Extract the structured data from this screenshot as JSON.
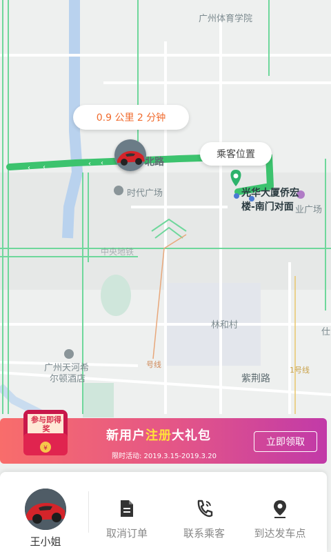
{
  "map": {
    "labels": {
      "sports_college": "广州体育学院",
      "times_square": "时代广场",
      "plaza_partial": "业广场",
      "metro_partial": "中央地铁",
      "linhe_village": "林和村",
      "hilton_line1": "广州天河希",
      "hilton_line2": "尔顿酒店",
      "zijing_road": "紫荆路",
      "road_north": "北路",
      "line_tag_left": "号线",
      "line_tag_right": "1号线",
      "right_edge": "仕"
    },
    "eta_text": "0.9 公里 2 分钟",
    "passenger_location_label": "乘客位置",
    "pickup_line1": "光华大厦侨宏",
    "pickup_line2": "楼-南门对面",
    "route_color": "#3cc36e",
    "pin_color": "#2db36b"
  },
  "promo": {
    "badge": "参与即得奖",
    "title_pre": "新用户",
    "title_highlight": "注册",
    "title_post": "大礼包",
    "date": "限时活动: 2019.3.15-2019.3.20",
    "button": "立即领取"
  },
  "panel": {
    "user_name": "王小姐",
    "actions": [
      {
        "label": "取消订单",
        "icon": "document-icon"
      },
      {
        "label": "联系乘客",
        "icon": "phone-icon"
      },
      {
        "label": "到达发车点",
        "icon": "location-pin-icon"
      }
    ]
  }
}
